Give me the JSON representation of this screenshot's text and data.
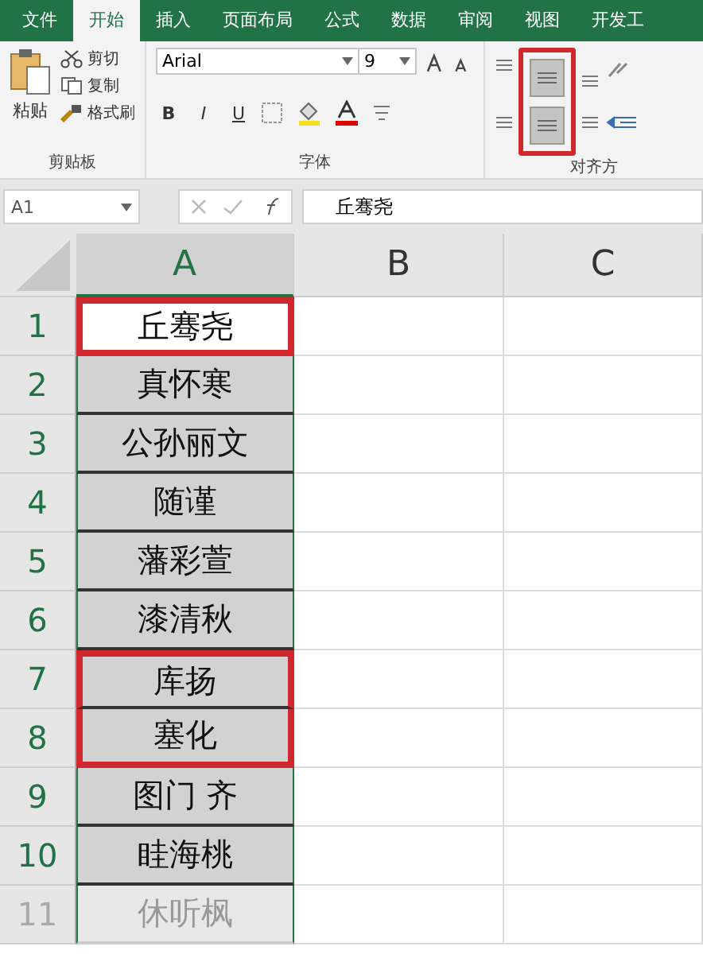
{
  "tabs": [
    {
      "label": "文件",
      "selected": false
    },
    {
      "label": "开始",
      "selected": true
    },
    {
      "label": "插入",
      "selected": false
    },
    {
      "label": "页面布局",
      "selected": false
    },
    {
      "label": "公式",
      "selected": false
    },
    {
      "label": "数据",
      "selected": false
    },
    {
      "label": "审阅",
      "selected": false
    },
    {
      "label": "视图",
      "selected": false
    },
    {
      "label": "开发工",
      "selected": false
    }
  ],
  "clipboard": {
    "paste": "粘贴",
    "cut": "剪切",
    "copy": "复制",
    "format_painter": "格式刷",
    "label": "剪贴板"
  },
  "font": {
    "name": "Arial",
    "size": "9",
    "label": "字体",
    "bold": "B",
    "italic": "I",
    "underline": "U"
  },
  "alignment": {
    "label": "对齐方",
    "center_selected": true,
    "boxed": true
  },
  "name_box": "A1",
  "formula": "丘骞尧",
  "columns": [
    {
      "label": "A",
      "selected": true
    },
    {
      "label": "B",
      "selected": false
    },
    {
      "label": "C",
      "selected": false
    }
  ],
  "rows": [
    {
      "number": "1",
      "value": "丘骞尧",
      "selected": true,
      "active": true,
      "boxed": true,
      "dimmed": false
    },
    {
      "number": "2",
      "value": "真怀寒",
      "selected": true,
      "active": false,
      "boxed": false,
      "dimmed": false
    },
    {
      "number": "3",
      "value": "公孙丽文",
      "selected": true,
      "active": false,
      "boxed": false,
      "dimmed": false
    },
    {
      "number": "4",
      "value": "随谨",
      "selected": true,
      "active": false,
      "boxed": false,
      "dimmed": false
    },
    {
      "number": "5",
      "value": "藩彩萱",
      "selected": true,
      "active": false,
      "boxed": false,
      "dimmed": false
    },
    {
      "number": "6",
      "value": "漆清秋",
      "selected": true,
      "active": false,
      "boxed": false,
      "dimmed": false
    },
    {
      "number": "7",
      "value": "库扬",
      "selected": true,
      "active": false,
      "boxed": true,
      "dimmed": false
    },
    {
      "number": "8",
      "value": "塞化",
      "selected": true,
      "active": false,
      "boxed": true,
      "dimmed": false
    },
    {
      "number": "9",
      "value": "图门 齐",
      "selected": true,
      "active": false,
      "boxed": false,
      "dimmed": false
    },
    {
      "number": "10",
      "value": "眭海桃",
      "selected": true,
      "active": false,
      "boxed": false,
      "dimmed": false
    },
    {
      "number": "11",
      "value": "休听枫",
      "selected": true,
      "active": false,
      "boxed": false,
      "dimmed": true
    }
  ]
}
